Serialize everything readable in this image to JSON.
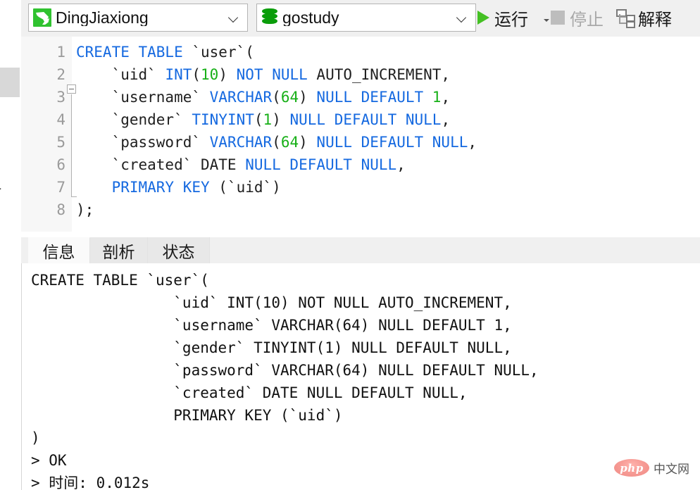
{
  "toolbar": {
    "connection": {
      "name": "DingJiaxiong",
      "icon": "mysql-dolphin-icon",
      "chevron": "chevron-down-icon"
    },
    "database": {
      "name": "gostudy",
      "icon": "database-cylinder-icon",
      "chevron": "chevron-down-icon"
    },
    "run_label": "运行",
    "run_icon": "play-triangle-icon",
    "run_dropdown_icon": "caret-down-icon",
    "stop_label": "停止",
    "stop_icon": "stop-square-icon",
    "stop_disabled": true,
    "explain_label": "解释",
    "explain_icon": "explain-tree-icon",
    "accent_green": "#44c023",
    "db_green": "#0a9d0a",
    "disabled_gray": "#a8a8a8"
  },
  "sidebar_remnant": {
    "text_fragment_1": "a",
    "text_fragment_2": "na"
  },
  "editor": {
    "line_numbers": [
      "1",
      "2",
      "3",
      "4",
      "5",
      "6",
      "7",
      "8"
    ],
    "fold_marker": "fold-collapse-icon",
    "syntax_colors": {
      "keyword": "#1569e0",
      "number": "#18b018",
      "plain": "#1f1f1f"
    },
    "lines": [
      [
        {
          "t": "CREATE TABLE ",
          "c": "kw"
        },
        {
          "t": "`user`(",
          "c": "pl"
        }
      ],
      [
        {
          "t": "    `uid` ",
          "c": "pl"
        },
        {
          "t": "INT",
          "c": "kw"
        },
        {
          "t": "(",
          "c": "pl"
        },
        {
          "t": "10",
          "c": "num"
        },
        {
          "t": ") ",
          "c": "pl"
        },
        {
          "t": "NOT NULL ",
          "c": "kw"
        },
        {
          "t": "AUTO_INCREMENT,",
          "c": "pl"
        }
      ],
      [
        {
          "t": "    `username` ",
          "c": "pl"
        },
        {
          "t": "VARCHAR",
          "c": "kw"
        },
        {
          "t": "(",
          "c": "pl"
        },
        {
          "t": "64",
          "c": "num"
        },
        {
          "t": ") ",
          "c": "pl"
        },
        {
          "t": "NULL DEFAULT ",
          "c": "kw"
        },
        {
          "t": "1",
          "c": "num"
        },
        {
          "t": ",",
          "c": "pl"
        }
      ],
      [
        {
          "t": "    `gender` ",
          "c": "pl"
        },
        {
          "t": "TINYINT",
          "c": "kw"
        },
        {
          "t": "(",
          "c": "pl"
        },
        {
          "t": "1",
          "c": "num"
        },
        {
          "t": ") ",
          "c": "pl"
        },
        {
          "t": "NULL DEFAULT NULL",
          "c": "kw"
        },
        {
          "t": ",",
          "c": "pl"
        }
      ],
      [
        {
          "t": "    `password` ",
          "c": "pl"
        },
        {
          "t": "VARCHAR",
          "c": "kw"
        },
        {
          "t": "(",
          "c": "pl"
        },
        {
          "t": "64",
          "c": "num"
        },
        {
          "t": ") ",
          "c": "pl"
        },
        {
          "t": "NULL DEFAULT NULL",
          "c": "kw"
        },
        {
          "t": ",",
          "c": "pl"
        }
      ],
      [
        {
          "t": "    `created` DATE ",
          "c": "pl"
        },
        {
          "t": "NULL DEFAULT NULL",
          "c": "kw"
        },
        {
          "t": ",",
          "c": "pl"
        }
      ],
      [
        {
          "t": "    ",
          "c": "pl"
        },
        {
          "t": "PRIMARY KEY ",
          "c": "kw"
        },
        {
          "t": "(`uid`)",
          "c": "pl"
        }
      ],
      [
        {
          "t": ");",
          "c": "pl"
        }
      ]
    ]
  },
  "results": {
    "tabs": [
      {
        "label": "信息",
        "active": true
      },
      {
        "label": "剖析",
        "active": false
      },
      {
        "label": "状态",
        "active": false
      }
    ],
    "output_lines": [
      "CREATE TABLE `user`(",
      "                `uid` INT(10) NOT NULL AUTO_INCREMENT,",
      "                `username` VARCHAR(64) NULL DEFAULT 1,",
      "                `gender` TINYINT(1) NULL DEFAULT NULL,",
      "                `password` VARCHAR(64) NULL DEFAULT NULL,",
      "                `created` DATE NULL DEFAULT NULL,",
      "                PRIMARY KEY (`uid`)",
      ")",
      "> OK",
      "> 时间: 0.012s"
    ],
    "status": "OK",
    "time_label": "时间",
    "time_value": "0.012s"
  },
  "watermark": {
    "logo_text": "php",
    "site_text": "中文网",
    "logo_color": "#ef8a84"
  }
}
